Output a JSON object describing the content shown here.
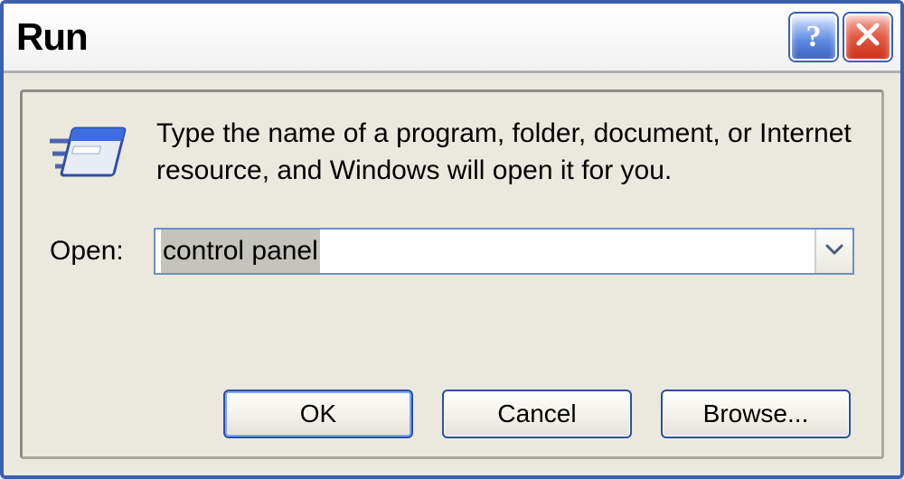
{
  "window": {
    "title": "Run"
  },
  "instruction": "Type the name of a program, folder, document, or Internet resource, and Windows will open it for you.",
  "open_label": "Open:",
  "open_value": "control panel",
  "buttons": {
    "ok": "OK",
    "cancel": "Cancel",
    "browse": "Browse..."
  },
  "icons": {
    "help": "?",
    "close": "close-icon",
    "run": "run-dialog-icon",
    "dropdown": "chevron-down-icon"
  }
}
